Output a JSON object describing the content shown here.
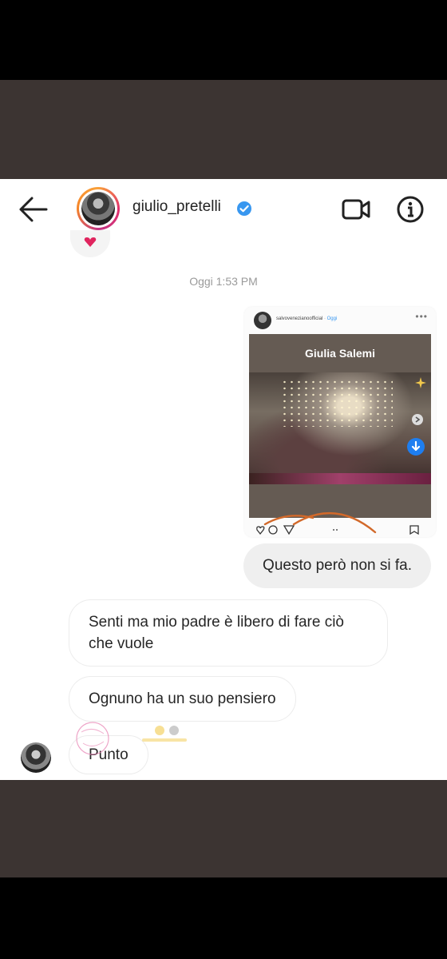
{
  "header": {
    "username": "giulio_pretelli"
  },
  "chat": {
    "timestamp": "Oggi 1:53 PM",
    "shared_post": {
      "account": "salvovenezianoofficial",
      "separator": "·",
      "time": "Oggi",
      "story_title": "Giulia Salemi"
    },
    "messages": [
      {
        "from": "me",
        "text": "Questo però non si fa."
      },
      {
        "from": "them",
        "text": "Senti ma mio padre è libero di fare ciò che vuole"
      },
      {
        "from": "them",
        "text": "Ognuno ha un suo pensiero"
      },
      {
        "from": "them",
        "text": "Punto"
      }
    ]
  },
  "colors": {
    "verified": "#3897f0",
    "heart": "#e0245e",
    "bubble_out": "#efefef",
    "letterbox": "#3c3432"
  }
}
